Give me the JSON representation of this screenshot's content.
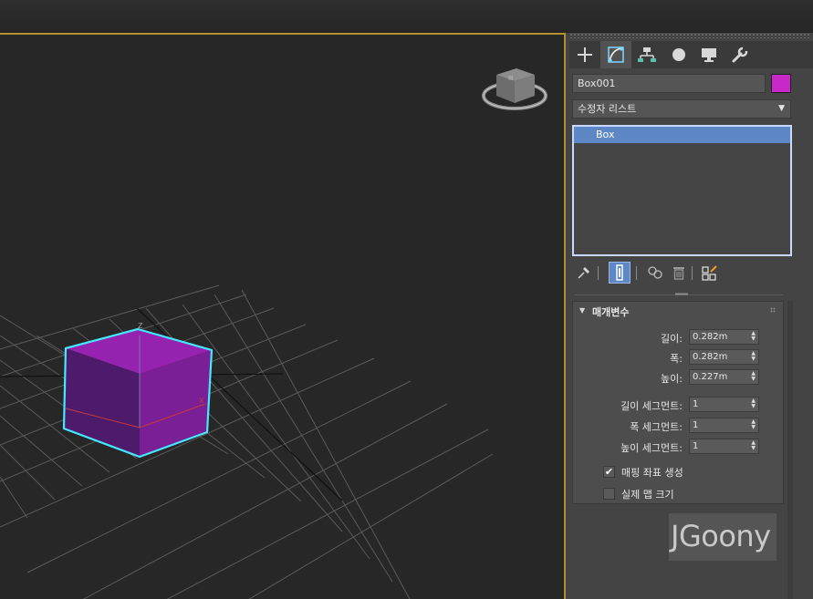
{
  "command_panel": {
    "tabs": [
      {
        "name": "create-tab",
        "icon": "plus-icon"
      },
      {
        "name": "modify-tab",
        "icon": "modify-curve-icon",
        "active": true
      },
      {
        "name": "hierarchy-tab",
        "icon": "hierarchy-icon"
      },
      {
        "name": "motion-tab",
        "icon": "motion-icon"
      },
      {
        "name": "display-tab",
        "icon": "display-monitor-icon"
      },
      {
        "name": "utilities-tab",
        "icon": "wrench-icon"
      }
    ],
    "object_name": "Box001",
    "object_color": "#c828c8",
    "modifier_list": "수정자 리스트",
    "stack_items": [
      "Box"
    ],
    "rollout": {
      "title": "매개변수",
      "params": [
        {
          "label": "길이:",
          "value": "0.282m"
        },
        {
          "label": "폭:",
          "value": "0.282m"
        },
        {
          "label": "높이:",
          "value": "0.227m"
        }
      ],
      "segments": [
        {
          "label": "길이 세그먼트:",
          "value": "1"
        },
        {
          "label": "폭 세그먼트:",
          "value": "1"
        },
        {
          "label": "높이 세그먼트:",
          "value": "1"
        }
      ],
      "checks": [
        {
          "label": "매핑 좌표 생성",
          "checked": true
        },
        {
          "label": "실제 맵 크기",
          "checked": false
        }
      ]
    },
    "watermark": "JGoony"
  },
  "colors": {
    "viewport_border": "#b48f2d",
    "selection_highlight": "#5d87c5",
    "box_face": "#8a1fa8",
    "selection_outline": "#45e8ff"
  }
}
